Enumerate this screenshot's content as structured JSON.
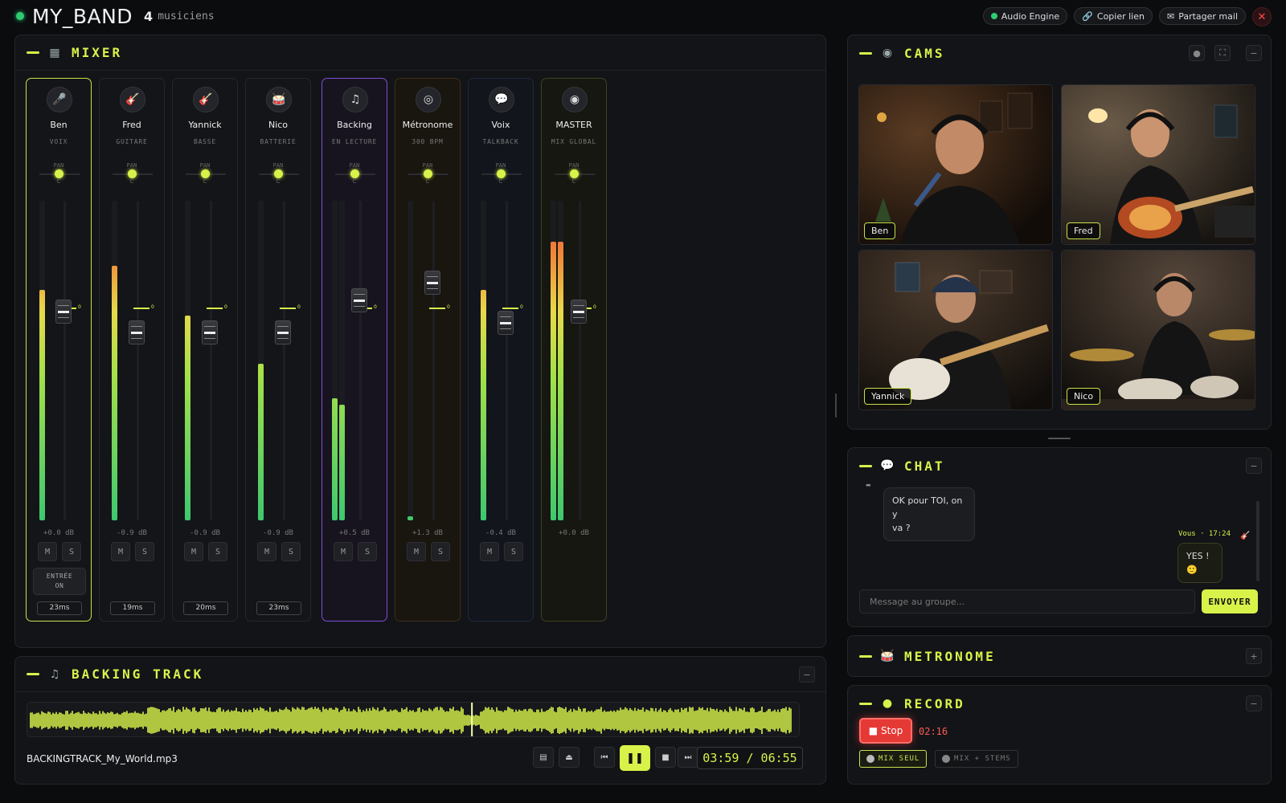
{
  "header": {
    "app_title": "MY_BAND",
    "musician_count": "4",
    "musician_label": "musiciens",
    "actions": {
      "audio_engine": "Audio Engine",
      "copy_link": "Copier lien",
      "share_mail": "Partager mail",
      "close": "✕"
    }
  },
  "mixer": {
    "title": "MIXER",
    "pan_label": "PAN",
    "pan_center": "C",
    "mute_label": "M",
    "solo_label": "S",
    "unity_label": "0",
    "input_label_line1": "ENTRÉE",
    "input_label_line2": "ON",
    "channels": [
      {
        "name": "Ben",
        "role": "VOIX",
        "db": "+0.0 dB",
        "latency": "23ms",
        "icon": "microphone-icon"
      },
      {
        "name": "Fred",
        "role": "GUITARE",
        "db": "-0.9 dB",
        "latency": "19ms",
        "icon": "guitar-icon"
      },
      {
        "name": "Yannick",
        "role": "BASSE",
        "db": "-0.9 dB",
        "latency": "20ms",
        "icon": "bass-icon"
      },
      {
        "name": "Nico",
        "role": "BATTERIE",
        "db": "-0.9 dB",
        "latency": "23ms",
        "icon": "drum-icon"
      },
      {
        "name": "Backing",
        "role": "EN LECTURE",
        "db": "+0.5 dB",
        "icon": "music-note-icon"
      },
      {
        "name": "Métronome",
        "role": "300 BPM",
        "db": "+1.3 dB",
        "icon": "target-icon"
      },
      {
        "name": "Voix",
        "role": "TALKBACK",
        "db": "-0.4 dB",
        "icon": "speech-bubble-icon"
      },
      {
        "name": "MASTER",
        "role": "MIX GLOBAL",
        "db": "+0.0 dB",
        "icon": "master-circle-icon"
      }
    ]
  },
  "backing_track": {
    "title": "BACKING TRACK",
    "filename": "BACKINGTRACK_My_World.mp3",
    "timecode": "03:59 / 06:55",
    "progress": 0.575,
    "minimize": "−"
  },
  "cams": {
    "title": "CAMS",
    "feeds": [
      "Ben",
      "Fred",
      "Yannick",
      "Nico"
    ]
  },
  "chat": {
    "title": "CHAT",
    "messages": [
      {
        "text_line1": "OK pour TOI, on y",
        "text_line2": "va ?"
      },
      {
        "meta": "Vous · 17:24",
        "text_line1": "YES !",
        "text_line2": "🙂"
      }
    ],
    "input_placeholder": "Message au groupe...",
    "send_label": "ENVOYER"
  },
  "metronome": {
    "title": "METRONOME",
    "expand": "+"
  },
  "record": {
    "title": "RECORD",
    "stop_label": "Stop",
    "elapsed": "02:16",
    "mode_mix": "MIX SEUL",
    "mode_stems": "MIX + STEMS"
  },
  "colors": {
    "accent": "#d8f24a",
    "record_red": "#e53935",
    "online_green": "#2ecc71"
  }
}
